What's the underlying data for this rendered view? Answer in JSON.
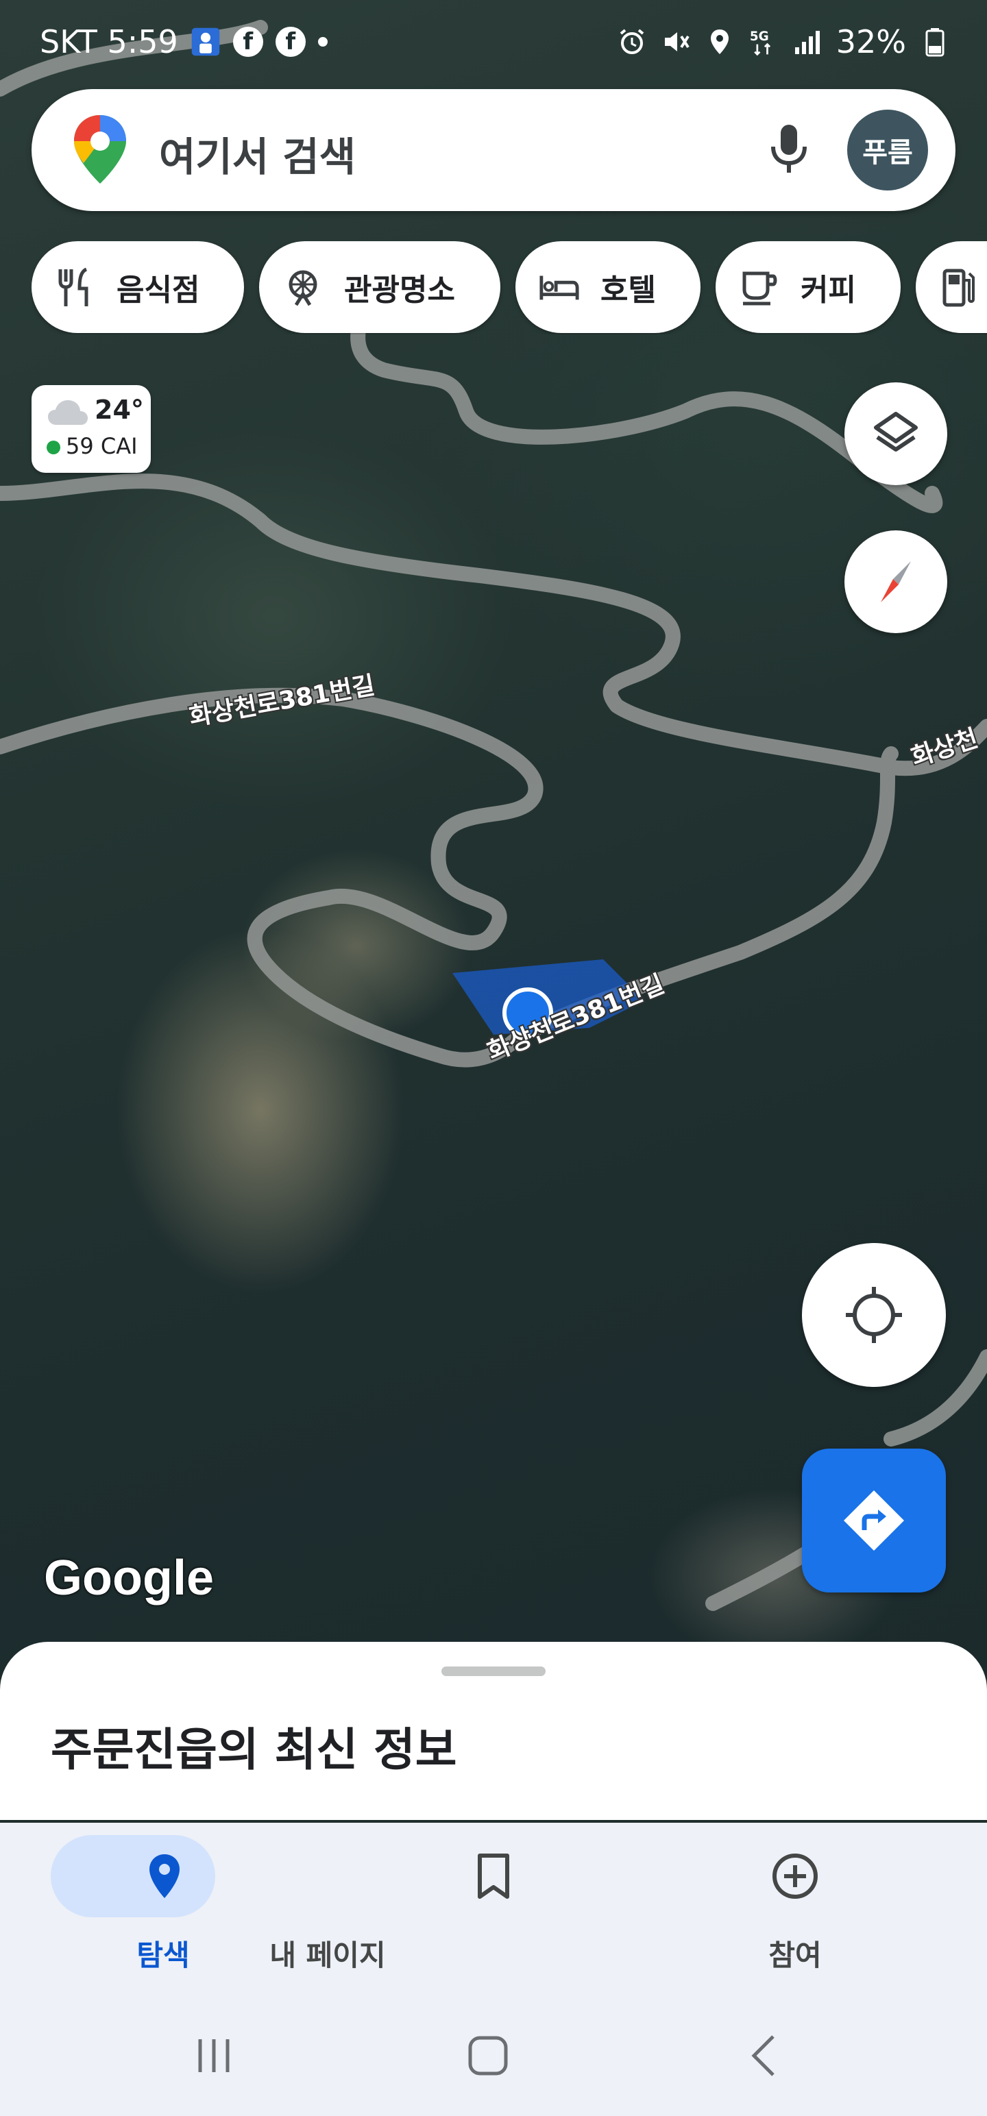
{
  "status_bar": {
    "carrier_time": "SKT 5:59",
    "battery": "32%",
    "network": "5G",
    "icons": [
      "app-notification-icon",
      "facebook-icon",
      "facebook-icon",
      "dot-icon",
      "alarm-icon",
      "mute-icon",
      "location-icon",
      "5g-icon",
      "signal-icon",
      "battery-icon"
    ]
  },
  "search": {
    "placeholder": "여기서 검색",
    "avatar_text": "푸름"
  },
  "chips": [
    {
      "label": "음식점",
      "icon": "restaurant-icon"
    },
    {
      "label": "관광명소",
      "icon": "attraction-icon"
    },
    {
      "label": "호텔",
      "icon": "hotel-icon"
    },
    {
      "label": "커피",
      "icon": "coffee-icon"
    },
    {
      "label": "",
      "icon": "gas-station-icon"
    }
  ],
  "weather": {
    "temp": "24°",
    "aqi": "59 CAI",
    "aqi_color": "#1ea446"
  },
  "map": {
    "road_labels": [
      "화상천로381번길",
      "화상천로381번길",
      "화상천"
    ],
    "attribution": "Google",
    "location_dot_color": "#1a73e8"
  },
  "sheet": {
    "title": "주문진읍의 최신 정보"
  },
  "bottom_nav": {
    "items": [
      {
        "label": "탐색",
        "icon": "explore-pin-icon",
        "active": true
      },
      {
        "label": "내 페이지",
        "icon": "bookmark-icon",
        "active": false
      },
      {
        "label": "참여",
        "icon": "add-circle-icon",
        "active": false
      }
    ]
  },
  "colors": {
    "accent": "#0b57d0",
    "directions_button": "#1a73e8",
    "active_pill": "#d3e3fd"
  }
}
